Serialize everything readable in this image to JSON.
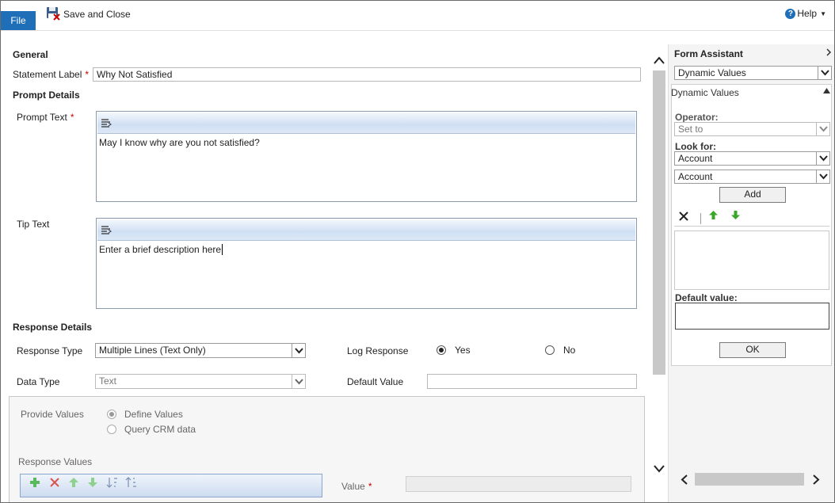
{
  "toolbar": {
    "file_label": "File",
    "save_close_label": "Save and Close",
    "help_label": "Help"
  },
  "general": {
    "heading": "General",
    "statement_label": "Statement Label",
    "statement_value": "Why Not Satisfied"
  },
  "prompt_details": {
    "heading": "Prompt Details",
    "prompt_label": "Prompt Text",
    "prompt_value": "May I know why are you not satisfied?",
    "tip_label": "Tip Text",
    "tip_value": "Enter a brief description here"
  },
  "response_details": {
    "heading": "Response Details",
    "response_type_label": "Response Type",
    "response_type_value": "Multiple Lines (Text Only)",
    "log_response_label": "Log Response",
    "yes_label": "Yes",
    "no_label": "No",
    "data_type_label": "Data Type",
    "data_type_value": "Text",
    "default_value_label": "Default Value",
    "default_value_value": ""
  },
  "provide_values": {
    "label": "Provide Values",
    "define_label": "Define Values",
    "query_label": "Query CRM data",
    "response_values_label": "Response Values",
    "value_label": "Value"
  },
  "form_assistant": {
    "title": "Form Assistant",
    "selected": "Dynamic Values",
    "section_title": "Dynamic Values",
    "operator_label": "Operator:",
    "operator_value": "Set to",
    "look_for_label": "Look for:",
    "look_for_value1": "Account",
    "look_for_value2": "Account",
    "add_label": "Add",
    "default_value_label": "Default value:",
    "ok_label": "OK"
  },
  "colors": {
    "file_tab": "#1e6fb8",
    "required": "#cc0000",
    "arrow_green": "#3aa62a"
  }
}
